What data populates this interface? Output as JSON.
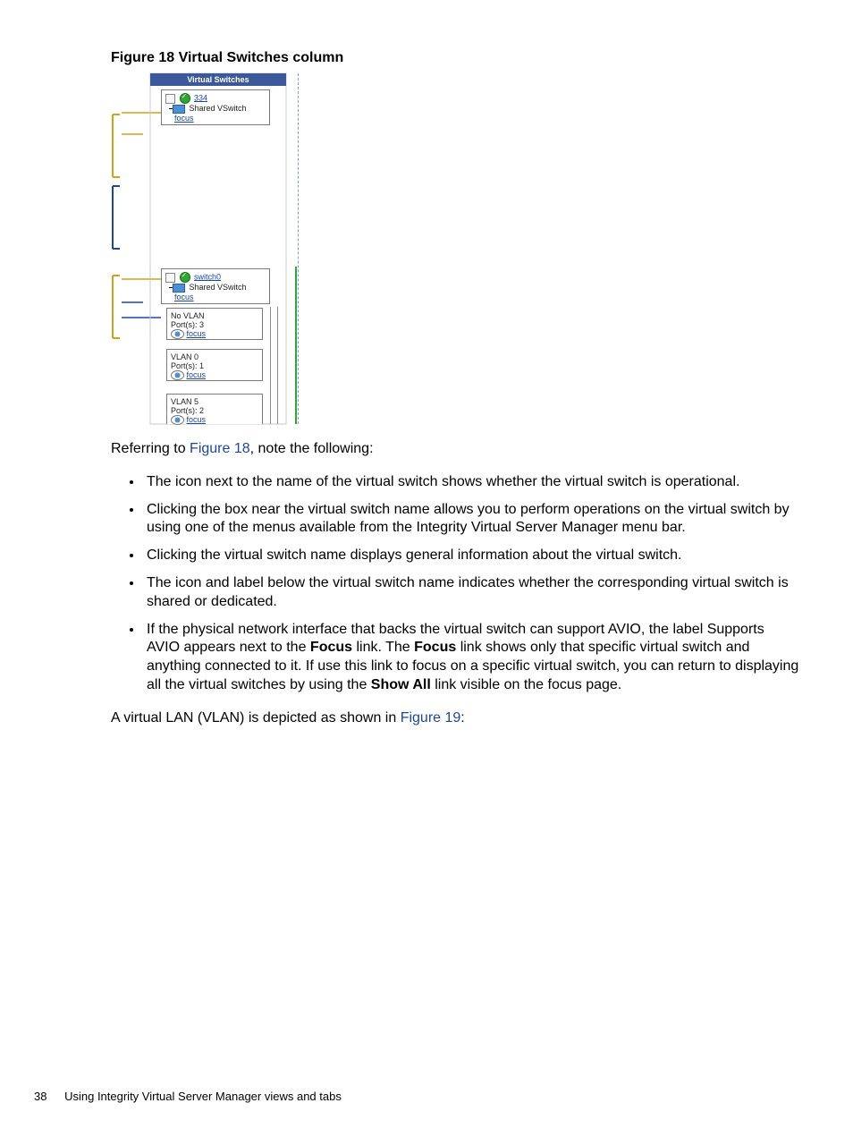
{
  "figure": {
    "title": "Figure 18 Virtual Switches column",
    "header": "Virtual Switches",
    "vs1": {
      "name": "334",
      "shared": "Shared VSwitch",
      "focus": "focus"
    },
    "vs2": {
      "name": "switch0",
      "shared": "Shared VSwitch",
      "focus": "focus"
    },
    "vlan_none": {
      "title": "No VLAN",
      "ports": "Port(s): 3",
      "focus": "focus"
    },
    "vlan0": {
      "title": "VLAN 0",
      "ports": "Port(s): 1",
      "focus": "focus"
    },
    "vlan5": {
      "title": "VLAN 5",
      "ports": "Port(s): 2",
      "focus": "focus"
    }
  },
  "intro": {
    "prefix": "Referring to ",
    "link": "Figure 18",
    "suffix": ", note the following:"
  },
  "bullets": {
    "b1": "The icon next to the name of the virtual switch shows whether the virtual switch is operational.",
    "b2": "Clicking the box near the virtual switch name allows you to perform operations on the virtual switch by using one of the menus available from the Integrity Virtual Server Manager menu bar.",
    "b3": "Clicking the virtual switch name displays general information about the virtual switch.",
    "b4": "The icon and label below the virtual switch name indicates whether the corresponding virtual switch is shared or dedicated.",
    "b5": {
      "t1": "If the physical network interface that backs the virtual switch can support AVIO, the label Supports AVIO appears next to the ",
      "bold1": "Focus",
      "t2": " link. The ",
      "bold2": "Focus",
      "t3": " link shows only that specific virtual switch and anything connected to it. If use this link to focus on a specific virtual switch, you can return to displaying all the virtual switches by using the ",
      "bold3": "Show All",
      "t4": " link visible on the focus page."
    }
  },
  "outro": {
    "prefix": "A virtual LAN (VLAN) is depicted as shown in ",
    "link": "Figure 19",
    "suffix": ":"
  },
  "footer": {
    "page": "38",
    "chapter": "Using Integrity Virtual Server Manager views and tabs"
  }
}
